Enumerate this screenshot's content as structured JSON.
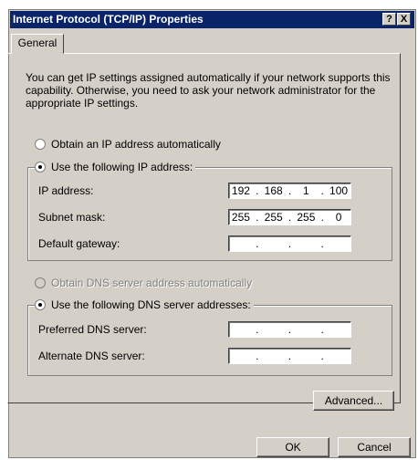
{
  "window": {
    "title": "Internet Protocol (TCP/IP) Properties"
  },
  "titlebar_buttons": {
    "help": "?",
    "close": "X"
  },
  "tabs": [
    {
      "label": "General"
    }
  ],
  "intro_text": "You can get IP settings assigned automatically if your network supports this capability. Otherwise, you need to ask your network administrator for the appropriate IP settings.",
  "ip_options": {
    "auto": "Obtain an IP address automatically",
    "manual": "Use the following IP address:"
  },
  "ip_fields": {
    "ip_address": {
      "label": "IP address:",
      "octets": [
        "192",
        "168",
        "1",
        "100"
      ]
    },
    "subnet_mask": {
      "label": "Subnet mask:",
      "octets": [
        "255",
        "255",
        "255",
        "0"
      ]
    },
    "default_gateway": {
      "label": "Default gateway:",
      "octets": [
        "",
        "",
        "",
        ""
      ]
    }
  },
  "dns_options": {
    "auto": "Obtain DNS server address automatically",
    "manual": "Use the following DNS server addresses:"
  },
  "dns_fields": {
    "preferred": {
      "label": "Preferred DNS server:",
      "octets": [
        "",
        "",
        "",
        ""
      ]
    },
    "alternate": {
      "label": "Alternate DNS server:",
      "octets": [
        "",
        "",
        "",
        ""
      ]
    }
  },
  "buttons": {
    "advanced": "Advanced...",
    "ok": "OK",
    "cancel": "Cancel"
  }
}
